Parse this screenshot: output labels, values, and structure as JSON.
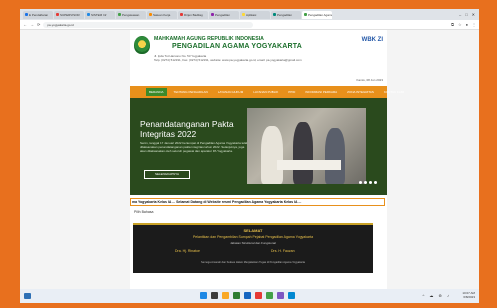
{
  "browser": {
    "tabs": [
      {
        "label": "E Pendaftaran",
        "color": "#1a73e8",
        "active": false
      },
      {
        "label": "SUPERVISOR",
        "color": "#e53935",
        "active": false
      },
      {
        "label": "SISTEM Inf",
        "color": "#1e88e5",
        "active": false
      },
      {
        "label": "Pengawasan",
        "color": "#43a047",
        "active": false
      },
      {
        "label": "Satuan Kerja",
        "color": "#fb8c00",
        "active": false
      },
      {
        "label": "Dirjen Badilag",
        "color": "#e53935",
        "active": false
      },
      {
        "label": "Pengadilan",
        "color": "#8e24aa",
        "active": false
      },
      {
        "label": "Aplikasi",
        "color": "#fdd835",
        "active": false
      },
      {
        "label": "Pengadilan",
        "color": "#00897b",
        "active": false
      },
      {
        "label": "Pengadilan Agama",
        "color": "#43a047",
        "active": true
      }
    ],
    "url": "pa-yogyakarta.go.id",
    "window_controls": [
      "–",
      "□",
      "✕"
    ]
  },
  "site": {
    "header": {
      "title1": "MAHKAMAH AGUNG REPUBLIK INDONESIA",
      "title2": "PENGADILAN AGAMA YOGYAKARTA",
      "address1": "Jl. Ipda Tut Harsono No. 53 Yogyakarta",
      "address2": "Telp. (0274) 512191, Fax. (0274) 512191, website: www.pa-yogyakarta.go.id, email: pa.yogyakarta@gmail.com",
      "wbs": "WBK ZI",
      "date": "Kamis, 08 Jun 2023"
    },
    "menu": [
      "BERANDA",
      "TENTANG PENGADILAN",
      "LAYANAN HUKUM",
      "LAYANAN PUBLIK",
      "PPID",
      "INFORMASI PERKARA",
      "ZONA INTEGRITAS",
      "KONTAK KAMI"
    ],
    "hero": {
      "title_line1": "Penandatanganan Pakta",
      "title_line2": "Integritas 2022",
      "description": "Senin, tanggal 17 Januari 2022 bertempat di Pengadilan Agama Yogyakarta telah dilaksanakan penandatanganan pakta integritas tahun 2022. Selanjutnya, juga akan dilaksanakan oleh seluruh pegawai dan aparatur PA Yogyakarta.",
      "button": "SELENGKAPNYA"
    },
    "marquee": "ma Yogyakarta Kelas IA ... Selamat Datang di Website resmi Pengadilan Agama Yogyakarta Kelas IA ...",
    "section_label": "Pilih Bahasa",
    "banner": {
      "line1": "SELAMAT",
      "line2": "Pelantikan dan Pengambilan Sumpah Pejabat Pengadilan Agama Yogyakarta",
      "line3": "Jabatan Struktural dan Fungsional",
      "name1": "Dra. Hj. Rinatoe",
      "name2": "Drs. H. Fauzan",
      "line4": "Semoga Amanah dan Sukses dalam Menjalankan Tugas di Pengadilan Agama Yogyakarta"
    }
  },
  "taskbar": {
    "icon_colors": [
      "#1e88e5",
      "#3b3b3b",
      "#f9a825",
      "#2e7d32",
      "#1565c0",
      "#e53935",
      "#43a047",
      "#7e57c2",
      "#0288d1"
    ],
    "time": "10:07 AM",
    "date": "6/8/2023",
    "tray_icons": "^ ☁ ⊚ ♪"
  }
}
